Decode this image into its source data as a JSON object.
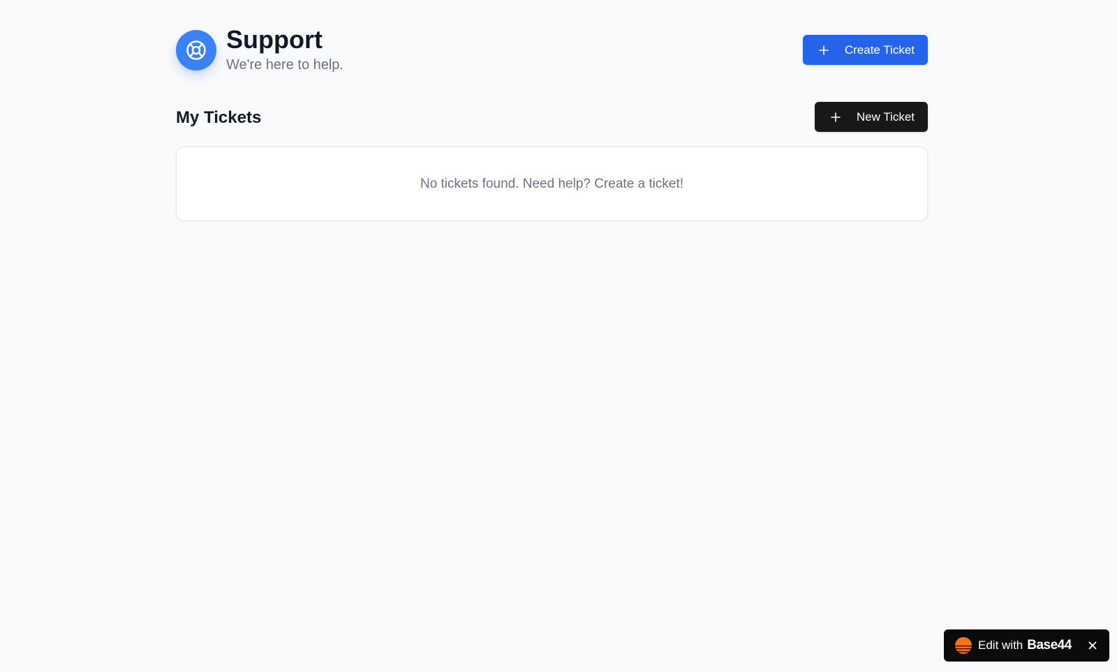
{
  "header": {
    "title": "Support",
    "subtitle": "We're here to help.",
    "logo_icon": "lifebuoy-icon",
    "create_button_label": "Create Ticket",
    "create_button_icon": "plus-icon"
  },
  "tickets": {
    "section_title": "My Tickets",
    "new_button_label": "New Ticket",
    "new_button_icon": "plus-icon",
    "empty_message": "No tickets found. Need help? Create a ticket!"
  },
  "badge": {
    "label": "Edit with",
    "brand": "Base44",
    "logo_icon": "base44-logo-icon",
    "close_icon": "close-icon"
  },
  "colors": {
    "background": "#f9fafb",
    "primary": "#2563eb",
    "logo_circle": "#3b82f6",
    "dark_button": "#18181b",
    "muted_text": "#6b7280",
    "badge_bg": "#0b0b0c",
    "badge_logo": "#f97316"
  }
}
